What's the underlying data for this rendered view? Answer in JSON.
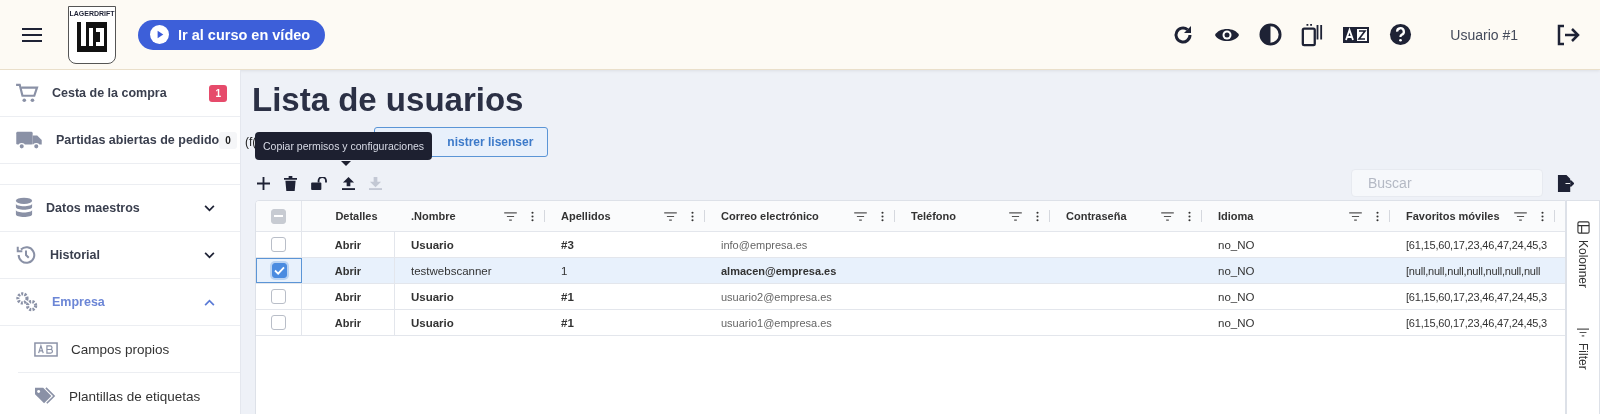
{
  "header": {
    "logo_text": "LAGERDRIFT",
    "video_button": "Ir al curso en vídeo",
    "icons": [
      {
        "kind": "refresh"
      },
      {
        "kind": "eye"
      },
      {
        "kind": "contrast"
      },
      {
        "kind": "device"
      },
      {
        "kind": "translate"
      },
      {
        "kind": "help"
      }
    ],
    "user": "Usuario #1"
  },
  "sidebar": {
    "items": [
      {
        "label": "Cesta de la compra",
        "kind": "cart",
        "badge": "1",
        "badge_alert": true
      },
      {
        "label": "Partidas abiertas de pedido",
        "kind": "truck",
        "badge": "0",
        "badge_alert": false
      },
      {
        "label": "Datos maestros",
        "kind": "database",
        "expanded": false,
        "active": false
      },
      {
        "label": "Historial",
        "kind": "history",
        "expanded": false,
        "active": false
      },
      {
        "label": "Empresa",
        "kind": "gears",
        "expanded": true,
        "active": true,
        "children": [
          {
            "label": "Campos propios",
            "kind": "ab"
          },
          {
            "label": "Plantillas de etiquetas",
            "kind": "tag"
          }
        ]
      }
    ]
  },
  "page": {
    "title": "Lista de usuarios",
    "note": "(f(",
    "licence_button": "nistrer lisenser",
    "tooltip": "Copiar permisos y configuraciones",
    "toolbar": [
      {
        "kind": "add",
        "disabled": false
      },
      {
        "kind": "delete",
        "disabled": false
      },
      {
        "kind": "unlock",
        "disabled": false
      },
      {
        "kind": "upload",
        "disabled": false
      },
      {
        "kind": "download",
        "disabled": true
      }
    ],
    "search": {
      "placeholder": "Buscar"
    }
  },
  "table": {
    "select_all_partial": true,
    "columns": [
      {
        "label": "Detalles",
        "menu": false
      },
      {
        "label": ".Nombre",
        "menu": true
      },
      {
        "label": "Apellidos",
        "menu": true
      },
      {
        "label": "Correo electrónico",
        "menu": true
      },
      {
        "label": "Teléfono",
        "menu": true
      },
      {
        "label": "Contraseña",
        "menu": true
      },
      {
        "label": "Idioma",
        "menu": true
      },
      {
        "label": "Favoritos móviles",
        "menu": true
      }
    ],
    "rows": [
      {
        "selected": false,
        "cells": [
          "Abrir",
          "Usuario",
          "#3",
          "info@empresa.es",
          "",
          "",
          "no_NO",
          "[61,15,60,17,23,46,47,24,45,3"
        ]
      },
      {
        "selected": true,
        "cells": [
          "Abrir",
          "testwebscanner",
          "1",
          "almacen@empresa.es",
          "",
          "",
          "no_NO",
          "[null,null,null,null,null,null,null"
        ]
      },
      {
        "selected": false,
        "cells": [
          "Abrir",
          "Usuario",
          "#1",
          "usuario2@empresa.es",
          "",
          "",
          "no_NO",
          "[61,15,60,17,23,46,47,24,45,3"
        ]
      },
      {
        "selected": false,
        "cells": [
          "Abrir",
          "Usuario",
          "#1",
          "usuario1@empresa.es",
          "",
          "",
          "no_NO",
          "[61,15,60,17,23,46,47,24,45,3"
        ]
      }
    ]
  },
  "side_panel": [
    {
      "label": "Kolonner",
      "kind": "columns"
    },
    {
      "label": "Filter",
      "kind": "filter"
    }
  ]
}
